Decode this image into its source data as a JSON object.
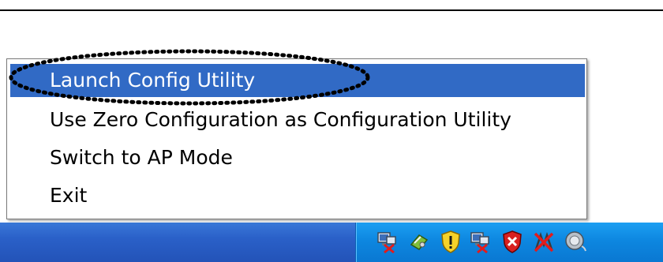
{
  "context_menu": {
    "items": [
      {
        "label": "Launch Config Utility",
        "selected": true
      },
      {
        "label": "Use Zero Configuration as Configuration Utility",
        "selected": false
      },
      {
        "label": "Switch to AP Mode",
        "selected": false
      },
      {
        "label": "Exit",
        "selected": false
      }
    ]
  },
  "tray": {
    "icons": [
      "network-disconnected-icon",
      "hardware-icon",
      "security-warning-shield-icon",
      "network-disconnected-icon",
      "security-alert-shield-icon",
      "wireless-disconnected-icon",
      "wireless-utility-icon"
    ]
  },
  "colors": {
    "selection": "#316ac5",
    "taskbar": "#2a60c8",
    "tray": "#0d87e0",
    "annotation_ring": "#000000"
  }
}
